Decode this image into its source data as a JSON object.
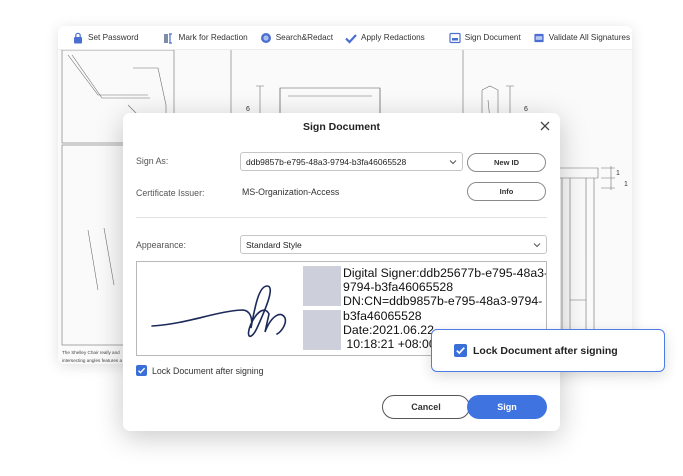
{
  "toolbar": {
    "items": [
      {
        "label": "Set Password",
        "icon": "lock-icon"
      },
      {
        "label": "Mark for Redaction",
        "icon": "redaction-mark-icon"
      },
      {
        "label": "Search&Redact",
        "icon": "search-icon"
      },
      {
        "label": "Apply Redactions",
        "icon": "checkmark-icon"
      },
      {
        "label": "Sign Document",
        "icon": "sign-document-icon"
      },
      {
        "label": "Validate All Signatures",
        "icon": "validate-signatures-icon"
      }
    ]
  },
  "document": {
    "dimension_labels": [
      "6",
      "6",
      "1",
      "1"
    ],
    "caption": "The Shelley Chair really and intersecting angles features a sloped, curv a leather seat with inte"
  },
  "dialog": {
    "title": "Sign Document",
    "sign_as_label": "Sign As:",
    "sign_as_value": "ddb9857b-e795-48a3-9794-b3fa46065528",
    "new_id_label": "New ID",
    "issuer_label": "Certificate Issuer:",
    "issuer_value": "MS-Organization-Access",
    "info_label": "Info",
    "appearance_label": "Appearance:",
    "appearance_value": "Standard Style",
    "signature_text_lines": [
      "Digital Signer:ddb25677b-e795-48a3-",
      "9794-b3fa46065528",
      "DN:CN=ddb9857b-e795-48a3-9794-",
      "b3fa46065528",
      "Date:2021.06.22",
      " 10:18:21 +08:00"
    ],
    "lock_label": "Lock Document after signing",
    "lock_checked": true,
    "cancel_label": "Cancel",
    "sign_label": "Sign"
  },
  "callout": {
    "lock_label": "Lock Document after signing",
    "lock_checked": true
  },
  "colors": {
    "accent": "#3f73e0",
    "callout_border": "#4c7de6",
    "placeholder_block": "#cdd0da"
  }
}
